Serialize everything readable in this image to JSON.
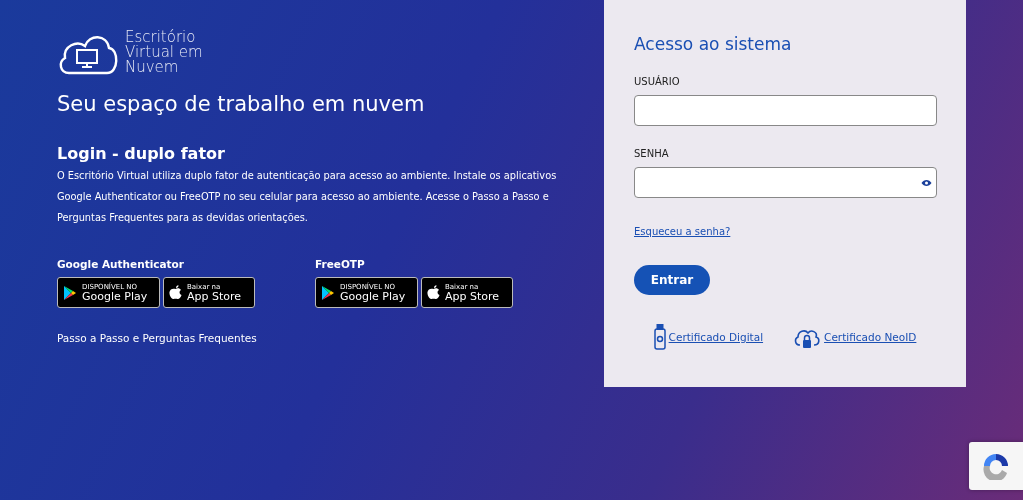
{
  "brand": {
    "lines": [
      "Escritório",
      "Virtual em",
      "Nuvem"
    ]
  },
  "tagline": "Seu espaço de trabalho em nuvem",
  "intro": {
    "title": "Login - duplo fator",
    "text": "O Escritório Virtual utiliza duplo fator de autenticação para acesso ao ambiente. Instale os aplicativos Google Authenticator ou FreeOTP no seu celular para acesso ao ambiente. Acesse o Passo a Passo e Perguntas Frequentes para as devidas orientações."
  },
  "apps": [
    {
      "name": "Google Authenticator",
      "badges": [
        {
          "kind": "play",
          "small": "DISPONÍVEL NO",
          "big": "Google Play"
        },
        {
          "kind": "apple",
          "small": "Baixar na",
          "big": "App Store"
        }
      ]
    },
    {
      "name": "FreeOTP",
      "badges": [
        {
          "kind": "play",
          "small": "DISPONÍVEL NO",
          "big": "Google Play"
        },
        {
          "kind": "apple",
          "small": "Baixar na",
          "big": "App Store"
        }
      ]
    }
  ],
  "help_link": "Passo a Passo e Perguntas Frequentes",
  "login": {
    "title": "Acesso ao sistema",
    "fields": [
      {
        "label": "USUÁRIO",
        "kind": "text"
      },
      {
        "label": "SENHA",
        "kind": "password"
      }
    ],
    "forgot": "Esqueceu a senha?",
    "submit": "Entrar",
    "certificates": [
      {
        "kind": "token",
        "label": "Certificado Digital"
      },
      {
        "kind": "cloud",
        "label": "Certificado NeoID"
      }
    ]
  }
}
